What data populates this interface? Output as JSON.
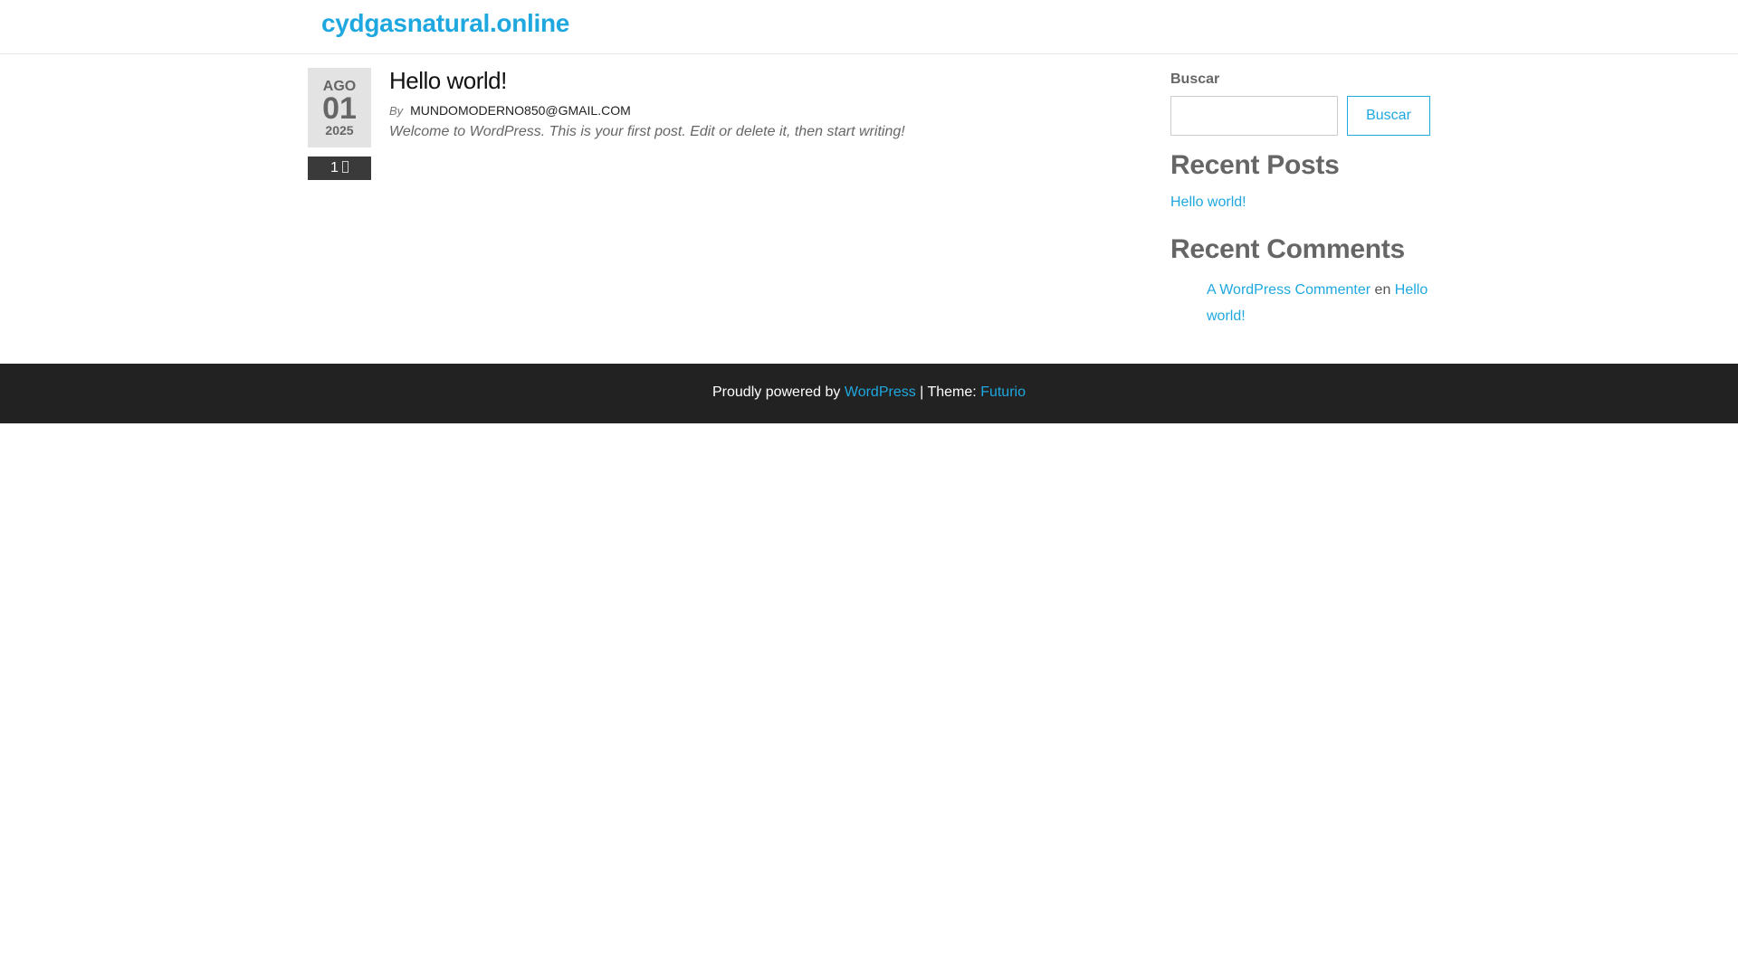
{
  "header": {
    "site_title": "cydgasnatural.online"
  },
  "post": {
    "date": {
      "month": "AGO",
      "day": "01",
      "year": "2025"
    },
    "comment_count": "1",
    "title": "Hello world!",
    "meta": {
      "by_label": "By",
      "author": "MUNDOMODERNO850@GMAIL.COM"
    },
    "excerpt": "Welcome to WordPress. This is your first post. Edit or delete it, then start writing!"
  },
  "sidebar": {
    "search": {
      "label": "Buscar",
      "value": "",
      "placeholder": "",
      "button_label": "Buscar"
    },
    "recent_posts": {
      "heading": "Recent Posts",
      "items": [
        "Hello world!"
      ]
    },
    "recent_comments": {
      "heading": "Recent Comments",
      "items": [
        {
          "author": "A WordPress Commenter",
          "connector": "en",
          "post": "Hello world!"
        }
      ]
    }
  },
  "footer": {
    "powered_by": "Proudly powered by",
    "wordpress_link": "WordPress",
    "separator": "|",
    "theme_label": "Theme:",
    "theme_link": "Futurio"
  },
  "colors": {
    "accent": "#1fa8df",
    "footer_bg": "#222222",
    "date_bg": "#e3e3e3",
    "comment_bg": "#3a3a3a"
  },
  "icons": {
    "comment": "comment-icon"
  }
}
